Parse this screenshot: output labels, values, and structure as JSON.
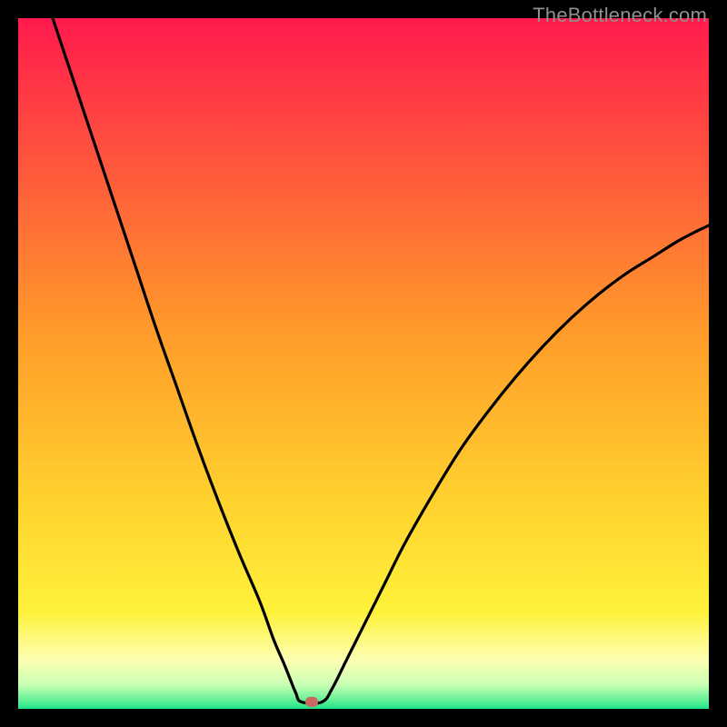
{
  "watermark": "TheBottleneck.com",
  "marker": {
    "color": "#c96a62"
  },
  "chart_data": {
    "type": "line",
    "title": "",
    "xlabel": "",
    "ylabel": "",
    "xlim": [
      0,
      100
    ],
    "ylim": [
      0,
      100
    ],
    "grid": false,
    "legend": false,
    "background_gradient": [
      {
        "pos": 0.0,
        "color": "#ff1a4d"
      },
      {
        "pos": 0.45,
        "color": "#ff9a2a"
      },
      {
        "pos": 0.7,
        "color": "#ffd22e"
      },
      {
        "pos": 0.86,
        "color": "#fff23a"
      },
      {
        "pos": 0.93,
        "color": "#fcffb3"
      },
      {
        "pos": 0.965,
        "color": "#c8ffb3"
      },
      {
        "pos": 0.985,
        "color": "#6ff29a"
      },
      {
        "pos": 1.0,
        "color": "#1ee68a"
      }
    ],
    "valley_x": 41,
    "marker_point": {
      "x": 42.5,
      "y": 1
    },
    "series": [
      {
        "name": "left-branch",
        "x": [
          5,
          8,
          11,
          14,
          17,
          20,
          23,
          26,
          29,
          32,
          35,
          37,
          38.5,
          39.5,
          40.2,
          41
        ],
        "y": [
          100,
          91,
          82,
          73,
          64,
          55,
          46.5,
          38,
          30,
          22.5,
          15.5,
          10,
          6.5,
          4,
          2.3,
          1
        ]
      },
      {
        "name": "floor",
        "x": [
          41,
          44
        ],
        "y": [
          1,
          1
        ]
      },
      {
        "name": "right-branch",
        "x": [
          44,
          45.5,
          47.5,
          50,
          53,
          56,
          60,
          64,
          68,
          72,
          76,
          80,
          84,
          88,
          92,
          96,
          100
        ],
        "y": [
          1,
          3,
          7,
          12,
          18,
          24,
          31,
          37.5,
          43,
          48,
          52.5,
          56.5,
          60,
          63,
          65.5,
          68,
          70
        ]
      }
    ]
  }
}
